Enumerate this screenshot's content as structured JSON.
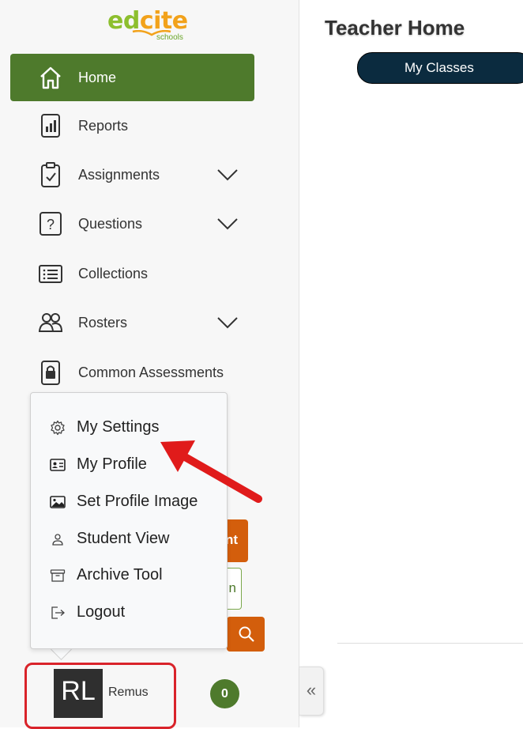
{
  "logo": {
    "word_part1": "ed",
    "word_part2": "cite",
    "sub": "schools"
  },
  "sidebar": {
    "items": [
      {
        "label": "Home",
        "icon": "home-icon",
        "active": true
      },
      {
        "label": "Reports",
        "icon": "reports-icon"
      },
      {
        "label": "Assignments",
        "icon": "clipboard-check-icon",
        "expandable": true
      },
      {
        "label": "Questions",
        "icon": "question-box-icon",
        "expandable": true
      },
      {
        "label": "Collections",
        "icon": "list-icon"
      },
      {
        "label": "Rosters",
        "icon": "people-icon",
        "expandable": true
      },
      {
        "label": "Common Assessments",
        "icon": "lock-icon"
      }
    ]
  },
  "hidden_buttons": {
    "orange_text": "nt",
    "outline_text": "n"
  },
  "user_menu": {
    "items": [
      {
        "label": "My Settings",
        "icon": "gear-icon"
      },
      {
        "label": "My Profile",
        "icon": "id-card-icon"
      },
      {
        "label": "Set Profile Image",
        "icon": "image-icon"
      },
      {
        "label": "Student View",
        "icon": "person-icon"
      },
      {
        "label": "Archive Tool",
        "icon": "archive-icon"
      },
      {
        "label": "Logout",
        "icon": "logout-icon"
      }
    ]
  },
  "user": {
    "initials": "RL",
    "name": "Remus",
    "notifications": "0"
  },
  "collapse": {
    "glyph": "«"
  },
  "main": {
    "title": "Teacher Home",
    "tab": "My Classes"
  },
  "colors": {
    "active_green": "#4e7a2c",
    "orange": "#d35e0c",
    "navy": "#0b2b3f",
    "highlight_red": "#d9232a"
  }
}
